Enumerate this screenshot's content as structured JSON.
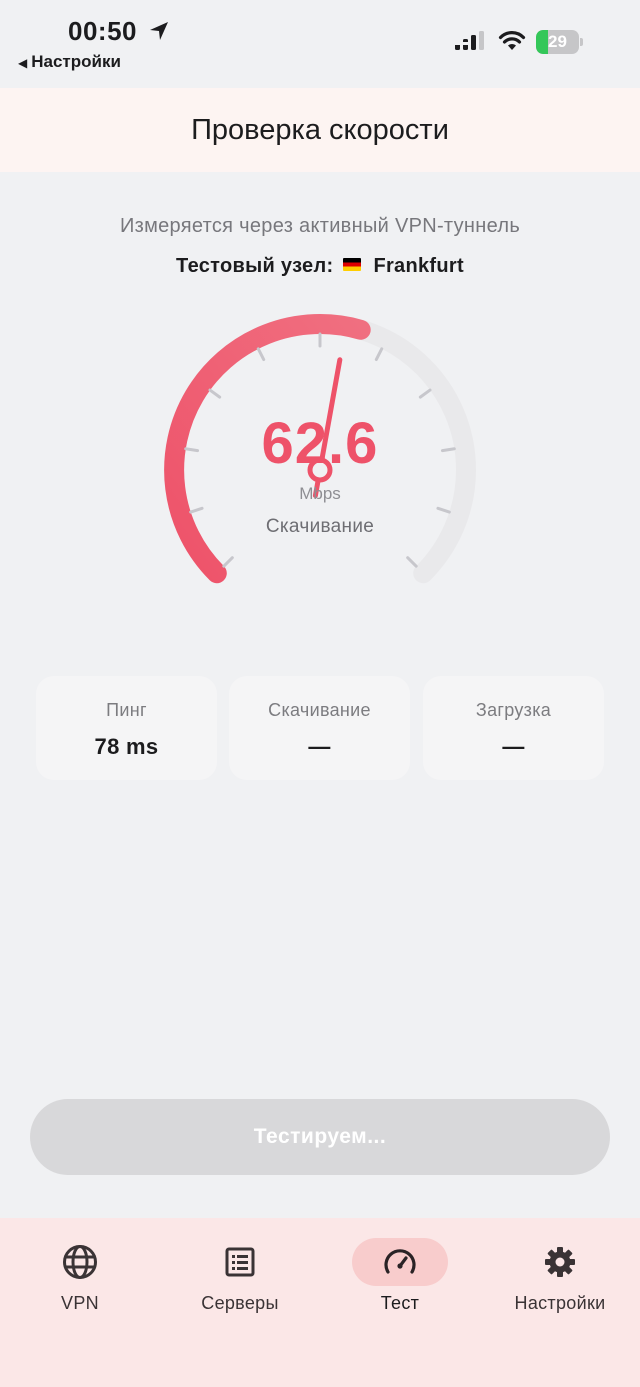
{
  "status_bar": {
    "time": "00:50",
    "back_label": "Настройки",
    "battery_percent": "29",
    "battery_level": 0.29
  },
  "header": {
    "title": "Проверка скорости"
  },
  "speedtest": {
    "subtitle": "Измеряется через активный VPN-туннель",
    "node_label": "Тестовый узел:",
    "node_name": "Frankfurt",
    "gauge": {
      "value": "62.6",
      "unit": "Mbps",
      "phase": "Скачивание",
      "fill_fraction": 0.56
    },
    "stats": [
      {
        "label": "Пинг",
        "value": "78 ms"
      },
      {
        "label": "Скачивание",
        "value": "—"
      },
      {
        "label": "Загрузка",
        "value": "—"
      }
    ],
    "button_label": "Тестируем..."
  },
  "tabs": [
    {
      "label": "VPN",
      "icon": "globe-icon",
      "active": false
    },
    {
      "label": "Серверы",
      "icon": "list-icon",
      "active": false
    },
    {
      "label": "Тест",
      "icon": "speedometer-icon",
      "active": true
    },
    {
      "label": "Настройки",
      "icon": "gear-icon",
      "active": false
    }
  ],
  "colors": {
    "accent": "#ee5269",
    "header_bg": "#fdf4f2",
    "tabbar_bg": "#fbe7e7",
    "active_tab_bg": "#f8cccc",
    "battery_fill": "#34c759"
  }
}
